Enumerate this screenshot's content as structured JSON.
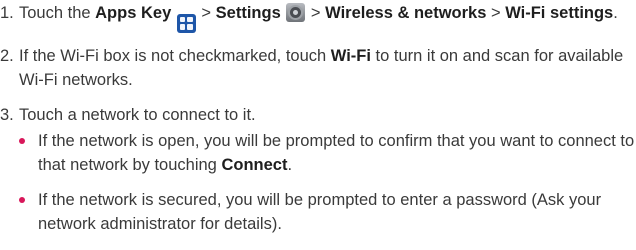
{
  "steps": [
    {
      "num": "1.",
      "t1": "Touch the ",
      "b1": "Apps Key",
      "icon1": "apps-key-icon",
      "t2": " > ",
      "b2": "Settings",
      "icon2": "settings-gear-icon",
      "t3": " > ",
      "b3": "Wireless & networks",
      "t4": " > ",
      "b4": "Wi-Fi settings",
      "t5": "."
    },
    {
      "num": "2.",
      "t1": "If the Wi-Fi box is not checkmarked, touch ",
      "b1": "Wi-Fi",
      "t2": " to turn it on and scan for available Wi-Fi networks."
    },
    {
      "num": "3.",
      "t1": "Touch a network to connect to it."
    }
  ],
  "bullets": [
    {
      "t1": "If the network is open, you will be prompted to confirm that you want to connect to that network by touching ",
      "b1": "Connect",
      "t2": "."
    },
    {
      "t1": "If the network is secured, you will be prompted to enter a password (Ask your network administrator for details)."
    }
  ],
  "colors": {
    "text": "#3a3a3a",
    "bold_text": "#1e1e1e",
    "bullet": "#d8175a",
    "apps_key": "#1e56a8"
  }
}
